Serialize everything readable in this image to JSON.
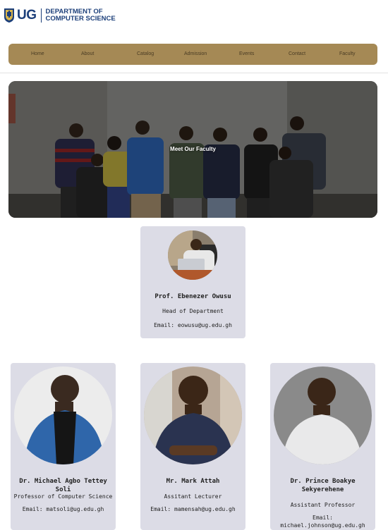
{
  "header": {
    "logo_text": "UG",
    "dept_line1": "DEPARTMENT OF",
    "dept_line2": "COMPUTER SCIENCE"
  },
  "nav": [
    "Home",
    "About",
    "Catalog",
    "Admission",
    "Events",
    "Contact",
    "Faculty"
  ],
  "hero": {
    "title": "Meet Our Faculty"
  },
  "head": {
    "name": "Prof. Ebenezer Owusu",
    "title": "Head of Department",
    "email": "Email: eowusu@ug.edu.gh"
  },
  "faculty": [
    {
      "name": "Dr. Michael Agbo Tettey Soli",
      "title": "Professor of Computer Science",
      "email": "Email: matsoli@ug.edu.gh"
    },
    {
      "name": "Mr. Mark Attah",
      "title": "Assitant Lecturer",
      "email": "Email: mamensah@ug.edu.gh"
    },
    {
      "name_line1": "Dr. Prince Boakye",
      "name_line2": "Sekyerehene",
      "title": "Assistant Professor",
      "email_line1": "Email:",
      "email_line2": "michael.johnson@ug.edu.gh"
    }
  ]
}
